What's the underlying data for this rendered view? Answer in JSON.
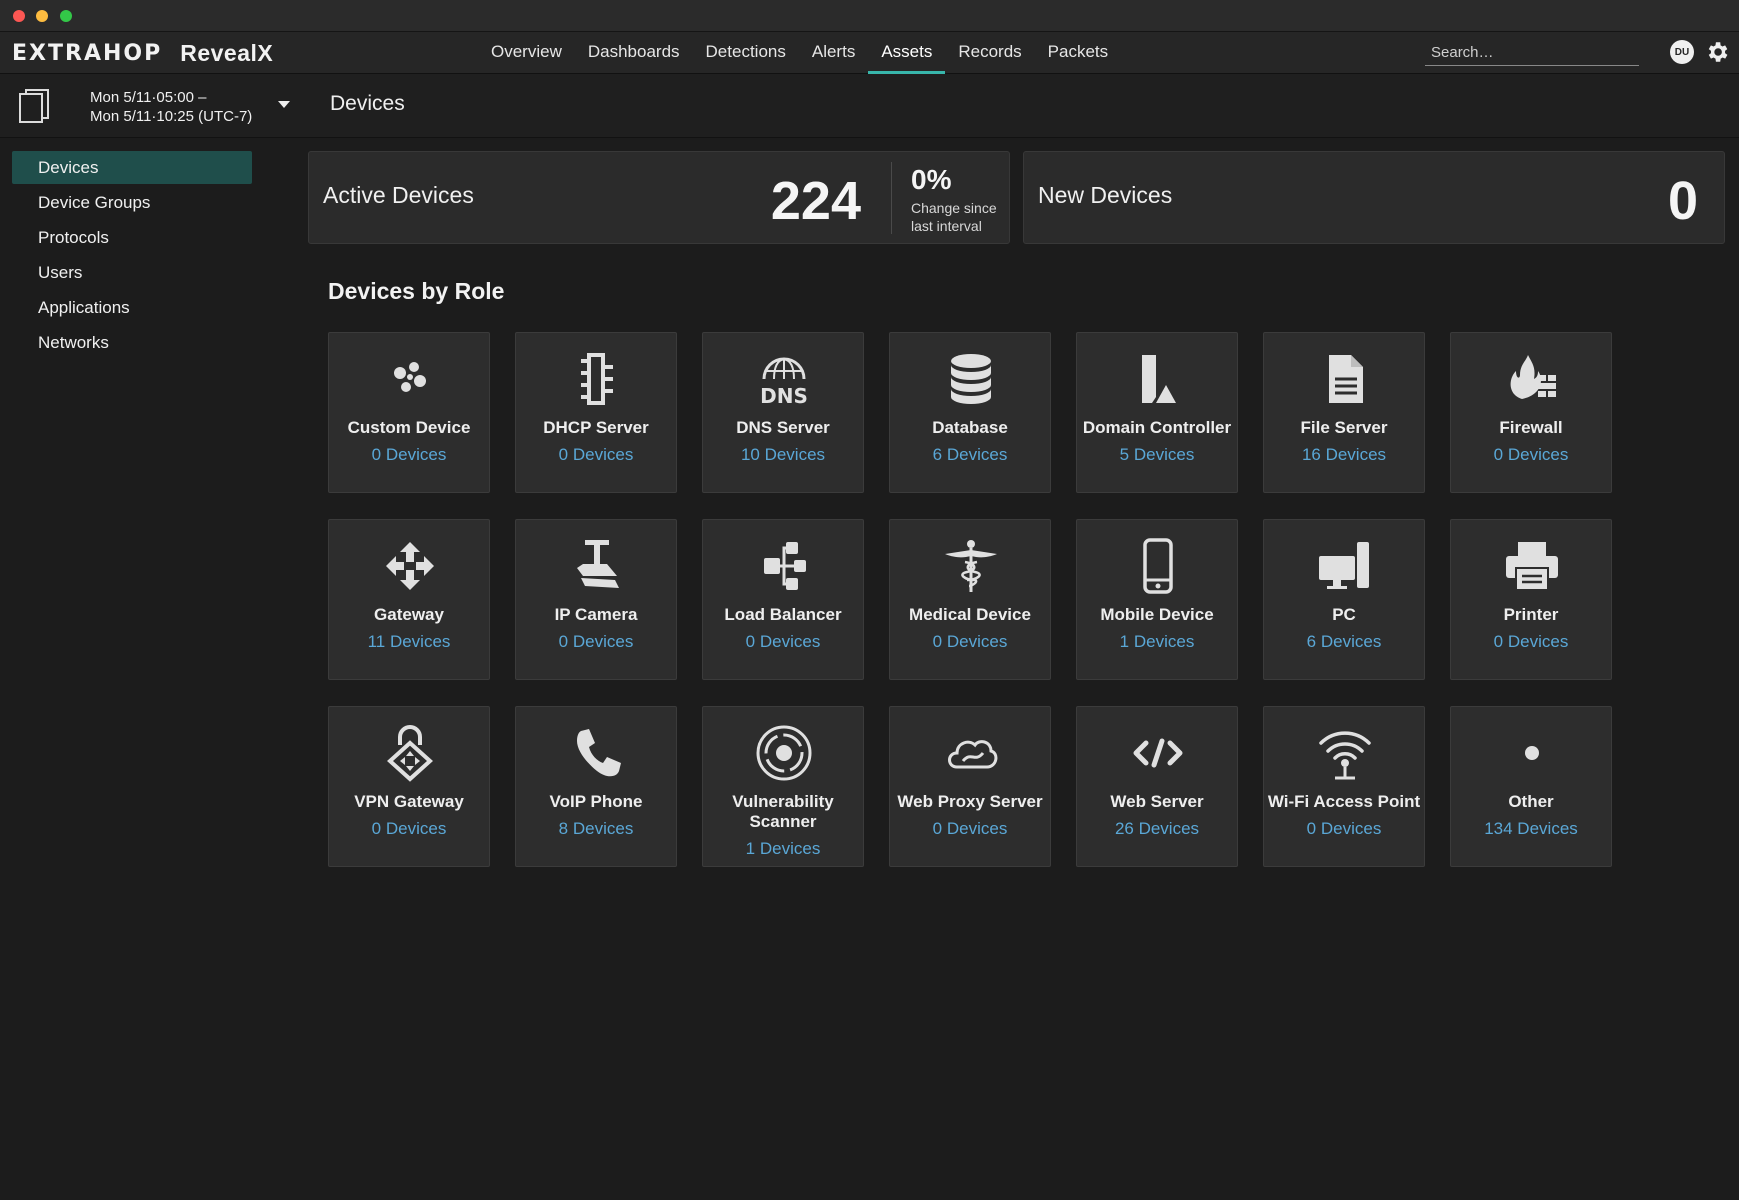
{
  "app": {
    "brand_logo": "EXTRAHOP",
    "brand_product": "RevealX"
  },
  "nav": {
    "items": [
      "Overview",
      "Dashboards",
      "Detections",
      "Alerts",
      "Assets",
      "Records",
      "Packets"
    ],
    "active": "Assets",
    "search_placeholder": "Search…",
    "user_initials": "DU"
  },
  "time_range": {
    "start": "Mon 5/11·05:00 –",
    "end": "Mon 5/11·10:25 (UTC-7)"
  },
  "page": {
    "title": "Devices"
  },
  "sidebar": {
    "items": [
      "Devices",
      "Device Groups",
      "Protocols",
      "Users",
      "Applications",
      "Networks"
    ],
    "active": "Devices"
  },
  "summary": {
    "active_devices": {
      "label": "Active Devices",
      "value": "224",
      "change": "0%",
      "change_caption": "Change since last interval"
    },
    "new_devices": {
      "label": "New Devices",
      "value": "0"
    }
  },
  "section": {
    "title": "Devices by Role"
  },
  "roles": [
    {
      "name": "Custom Device",
      "count": "0 Devices",
      "icon": "custom-device-icon"
    },
    {
      "name": "DHCP Server",
      "count": "0 Devices",
      "icon": "dhcp-server-icon"
    },
    {
      "name": "DNS Server",
      "count": "10 Devices",
      "icon": "dns-server-icon"
    },
    {
      "name": "Database",
      "count": "6 Devices",
      "icon": "database-icon"
    },
    {
      "name": "Domain Controller",
      "count": "5 Devices",
      "icon": "domain-controller-icon"
    },
    {
      "name": "File Server",
      "count": "16 Devices",
      "icon": "file-server-icon"
    },
    {
      "name": "Firewall",
      "count": "0 Devices",
      "icon": "firewall-icon"
    },
    {
      "name": "Gateway",
      "count": "11 Devices",
      "icon": "gateway-icon"
    },
    {
      "name": "IP Camera",
      "count": "0 Devices",
      "icon": "ip-camera-icon"
    },
    {
      "name": "Load Balancer",
      "count": "0 Devices",
      "icon": "load-balancer-icon"
    },
    {
      "name": "Medical Device",
      "count": "0 Devices",
      "icon": "medical-device-icon"
    },
    {
      "name": "Mobile Device",
      "count": "1 Devices",
      "icon": "mobile-device-icon"
    },
    {
      "name": "PC",
      "count": "6 Devices",
      "icon": "pc-icon"
    },
    {
      "name": "Printer",
      "count": "0 Devices",
      "icon": "printer-icon"
    },
    {
      "name": "VPN Gateway",
      "count": "0 Devices",
      "icon": "vpn-gateway-icon"
    },
    {
      "name": "VoIP Phone",
      "count": "8 Devices",
      "icon": "voip-phone-icon"
    },
    {
      "name": "Vulnerability Scanner",
      "count": "1 Devices",
      "icon": "vulnerability-scanner-icon"
    },
    {
      "name": "Web Proxy Server",
      "count": "0 Devices",
      "icon": "web-proxy-server-icon"
    },
    {
      "name": "Web Server",
      "count": "26 Devices",
      "icon": "web-server-icon"
    },
    {
      "name": "Wi-Fi Access Point",
      "count": "0 Devices",
      "icon": "wifi-access-point-icon"
    },
    {
      "name": "Other",
      "count": "134 Devices",
      "icon": "other-icon"
    }
  ],
  "colors": {
    "accent": "#38b6ab",
    "link": "#5aa7d6",
    "sidebar_active": "#1f4e4b"
  }
}
